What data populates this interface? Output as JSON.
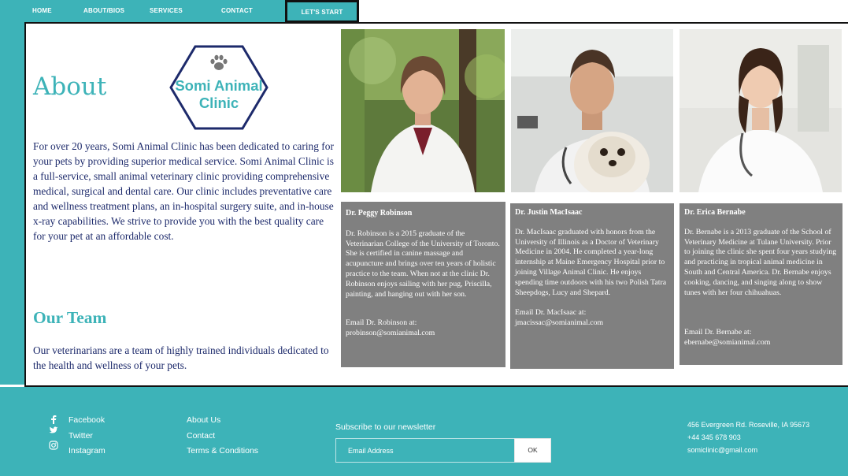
{
  "nav": {
    "items": [
      "HOME",
      "ABOUT/BIOS",
      "SERVICES",
      "CONTACT"
    ],
    "cta": "LET'S START"
  },
  "logo": {
    "line1": "Somi Animal",
    "line2": "Clinic",
    "icon": "paw-icon"
  },
  "about": {
    "heading": "About",
    "body": "For over 20 years, Somi Animal Clinic has been dedicated to caring for your pets by providing superior medical service. Somi Animal Clinic is a full-service, small animal veterinary clinic providing comprehensive medical, surgical and dental care. Our clinic includes preventative care and wellness treatment plans, an in-hospital surgery suite, and in-house x-ray capabilities. We strive to provide you with the best quality care for your pet at an affordable cost."
  },
  "team": {
    "heading": "Our Team",
    "body": "Our veterinarians are a team of highly trained individuals dedicated to the health and wellness of your pets."
  },
  "vets": [
    {
      "name": "Dr. Peggy Robinson",
      "bio": "Dr. Robinson is a 2015 graduate of the Veterinarian College of the University of Toronto. She is certified in canine massage and acupuncture and brings over ten years of holistic practice to the team. When not at the clinic Dr. Robinson enjoys sailing with her pug, Priscilla, painting, and hanging out with her son.",
      "email_label": "Email Dr. Robinson at:",
      "email": "probinson@somianimal.com"
    },
    {
      "name": "Dr. Justin MacIsaac",
      "bio": "Dr. MacIsaac graduated with honors from the University of Illinois as a Doctor of Veterinary Medicine in 2004. He completed a year-long internship at Maine Emergency Hospital prior to joining Village Animal Clinic. He enjoys spending time outdoors with his two Polish Tatra Sheepdogs, Lucy and Shepard.",
      "email_label": "Email Dr. MacIsaac at:",
      "email": "jmacissac@somianimal.com"
    },
    {
      "name": "Dr. Erica Bernabe",
      "bio": "Dr. Bernabe is a 2013 graduate of the School of Veterinary Medicine at Tulane University. Prior to joining the clinic she spent four years studying and practicing in tropical animal medicine in South and Central America. Dr. Bernabe enjoys cooking, dancing, and singing along to show tunes with her four chihuahuas.",
      "email_label": "Email Dr. Bernabe at:",
      "email": "ebernabe@somianimal.com"
    }
  ],
  "footer": {
    "social": [
      {
        "label": "Facebook",
        "icon": "facebook-icon"
      },
      {
        "label": "Twitter",
        "icon": "twitter-icon"
      },
      {
        "label": "Instagram",
        "icon": "instagram-icon"
      }
    ],
    "links": [
      "About Us",
      "Contact",
      "Terms & Conditions"
    ],
    "newsletter_label": "Subscribe to our newsletter",
    "email_placeholder": "Email Address",
    "ok_label": "OK",
    "address": "456 Evergreen Rd. Roseville, IA 95673",
    "phone": "+44 345 678 903",
    "email": "somiclinic@gmail.com"
  },
  "colors": {
    "accent": "#3db3b8",
    "text_navy": "#1d2a6b",
    "card_gray": "#808080"
  }
}
